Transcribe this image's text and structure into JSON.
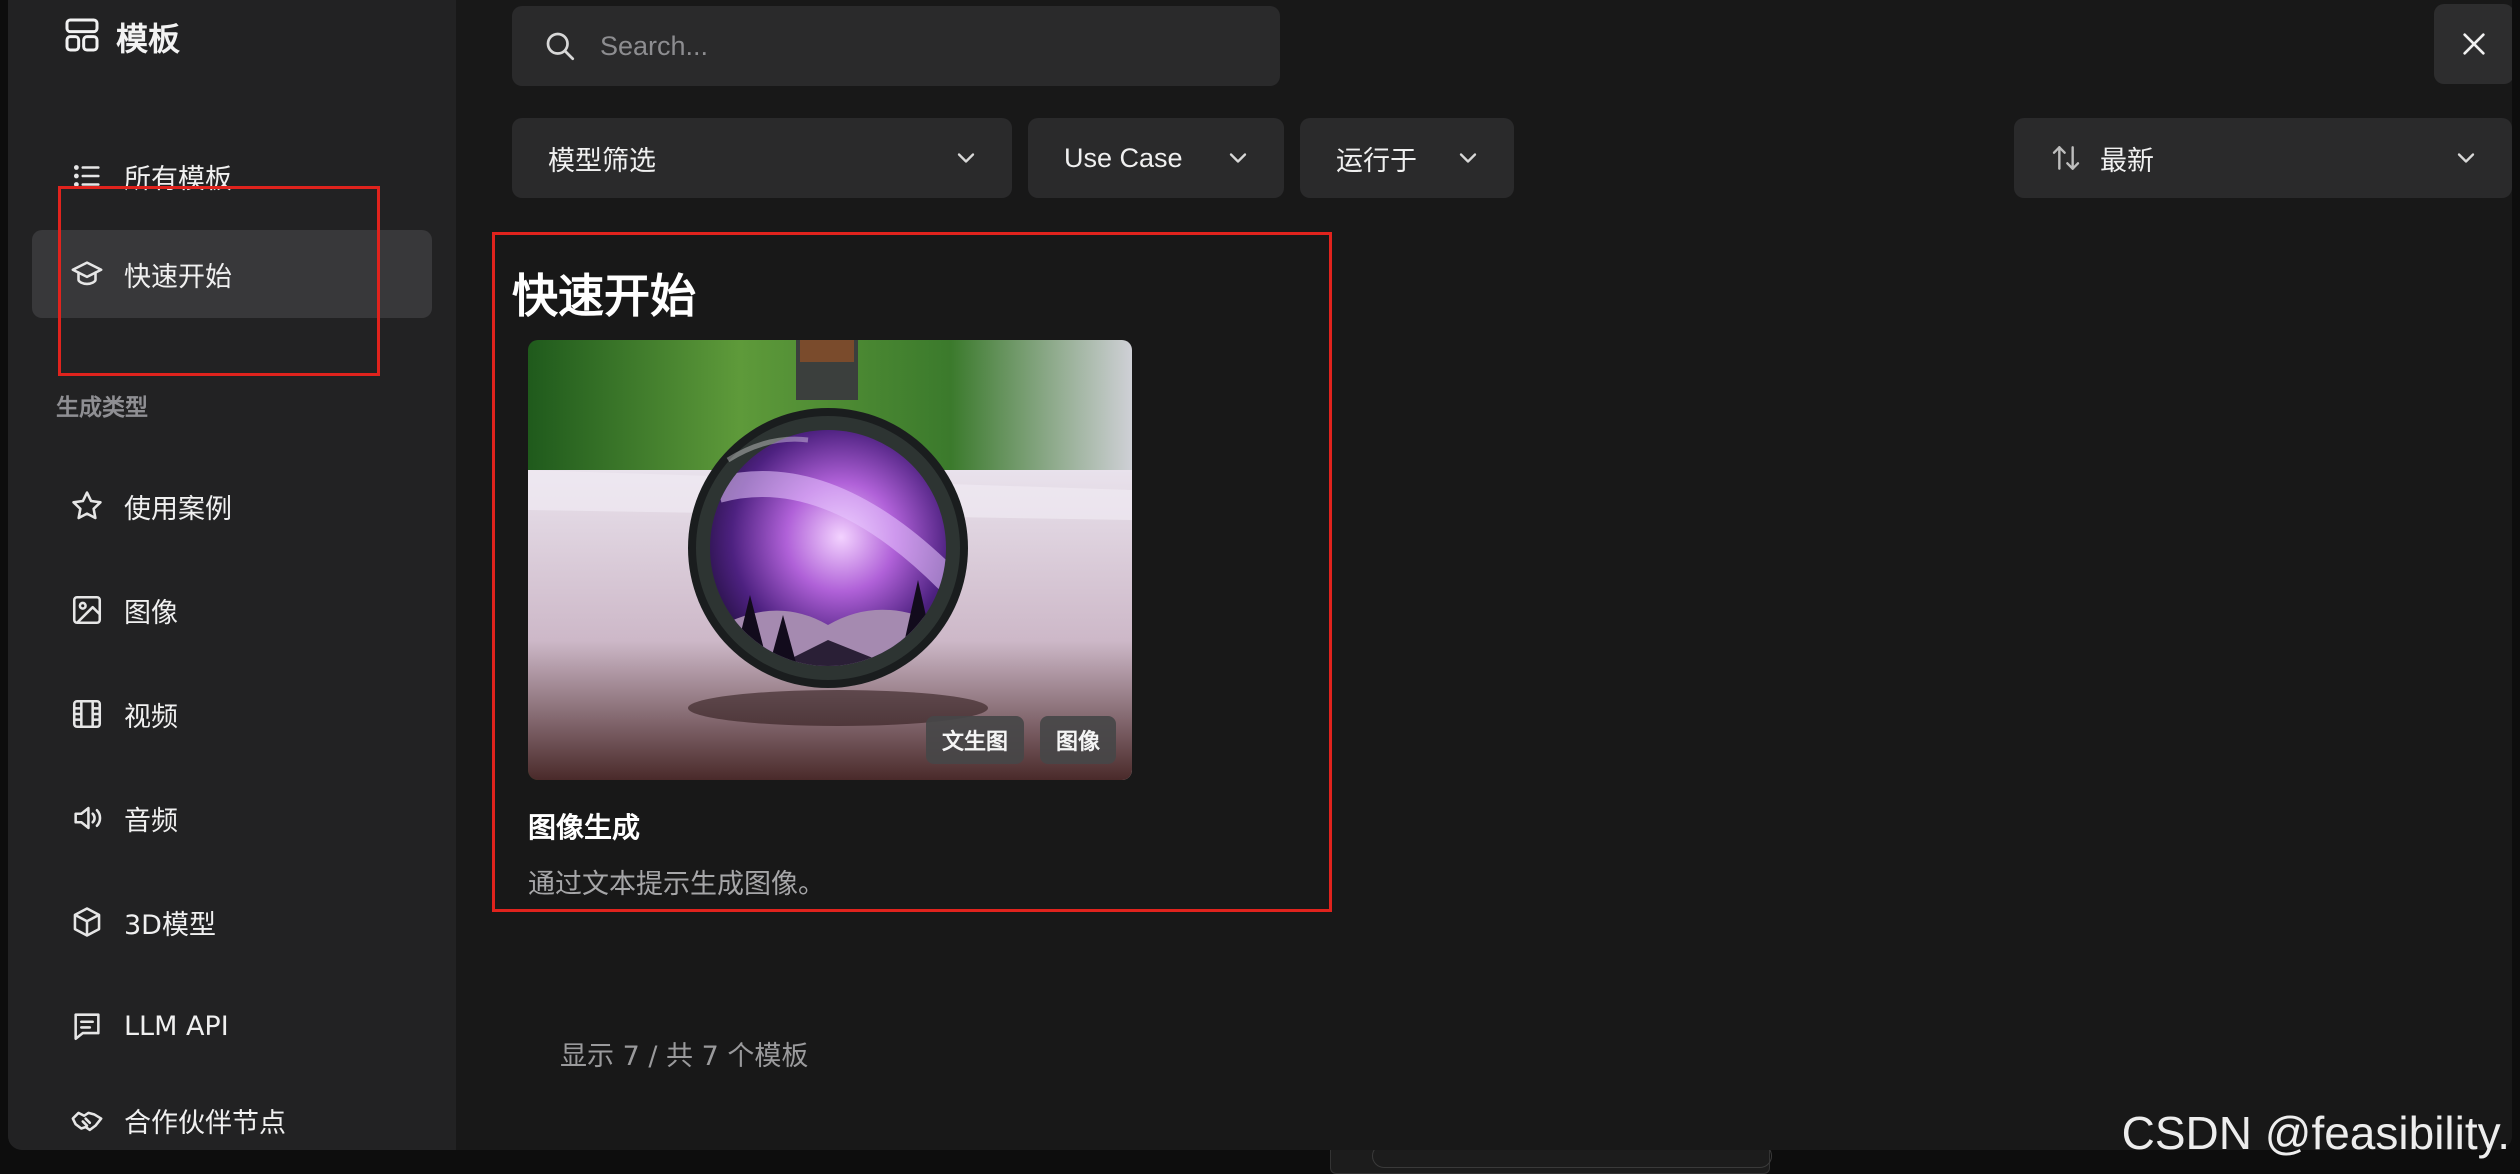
{
  "brand": {
    "title": "模板",
    "icon": "template-icon"
  },
  "sidebar": {
    "items": [
      {
        "label": "所有模板",
        "icon": "list-icon"
      },
      {
        "label": "快速开始",
        "icon": "graduation-cap-icon",
        "active": true
      }
    ],
    "section_label": "生成类型",
    "type_items": [
      {
        "label": "使用案例",
        "icon": "star-icon"
      },
      {
        "label": "图像",
        "icon": "image-icon"
      },
      {
        "label": "视频",
        "icon": "film-icon"
      },
      {
        "label": "音频",
        "icon": "speaker-icon"
      },
      {
        "label": "3D模型",
        "icon": "cube-icon"
      },
      {
        "label": "LLM API",
        "icon": "chat-icon"
      },
      {
        "label": "合作伙伴节点",
        "icon": "handshake-icon"
      }
    ]
  },
  "search": {
    "placeholder": "Search...",
    "value": ""
  },
  "filters": {
    "model": "模型筛选",
    "use_case": "Use Case",
    "runs_on": "运行于",
    "sort": "最新"
  },
  "section": {
    "title": "快速开始"
  },
  "cards": [
    {
      "title": "图像生成",
      "description": "通过文本提示生成图像。",
      "tags": [
        "文生图",
        "图像"
      ]
    }
  ],
  "footer": {
    "count_text": "显示 7 / 共 7 个模板"
  },
  "watermark": "CSDN @feasibility.",
  "colors": {
    "accent_red": "#e0231d",
    "sidebar_bg": "#222223",
    "main_bg": "#181818",
    "active_item_bg": "#38383a"
  }
}
